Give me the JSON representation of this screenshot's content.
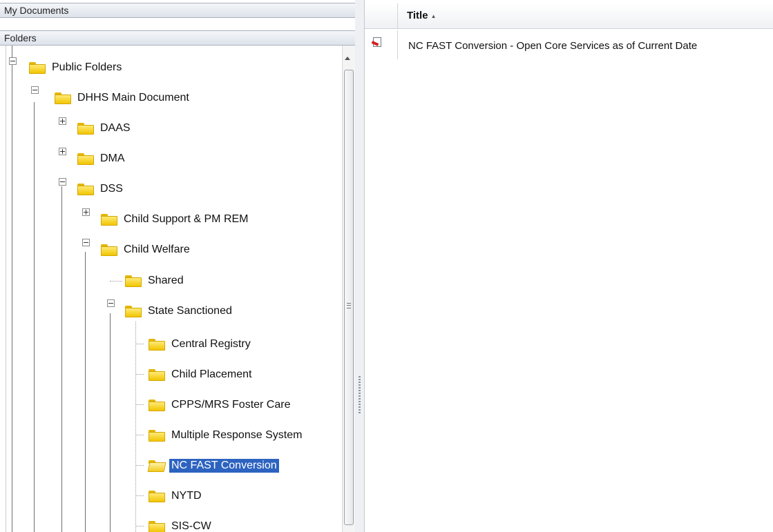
{
  "left_panel": {
    "my_documents_label": "My Documents",
    "folders_label": "Folders",
    "tree": [
      {
        "label": "Public Folders"
      },
      {
        "label": "DHHS Main Document"
      },
      {
        "label": "DAAS"
      },
      {
        "label": "DMA"
      },
      {
        "label": "DSS"
      },
      {
        "label": "Child Support & PM REM"
      },
      {
        "label": "Child Welfare"
      },
      {
        "label": "Shared"
      },
      {
        "label": "State Sanctioned"
      },
      {
        "label": "Central Registry"
      },
      {
        "label": "Child Placement"
      },
      {
        "label": "CPPS/MRS Foster Care"
      },
      {
        "label": "Multiple Response System"
      },
      {
        "label": "NC FAST Conversion"
      },
      {
        "label": "NYTD"
      },
      {
        "label": "SIS-CW"
      }
    ],
    "selected_folder": "NC FAST Conversion"
  },
  "right_panel": {
    "columns": {
      "title": "Title"
    },
    "sort_direction": "ascending",
    "rows": [
      {
        "title": "NC FAST Conversion - Open Core Services as of Current Date",
        "icon": "document-icon"
      }
    ]
  },
  "colors": {
    "selection": "#2d63c0",
    "folder": "#f1c500"
  }
}
